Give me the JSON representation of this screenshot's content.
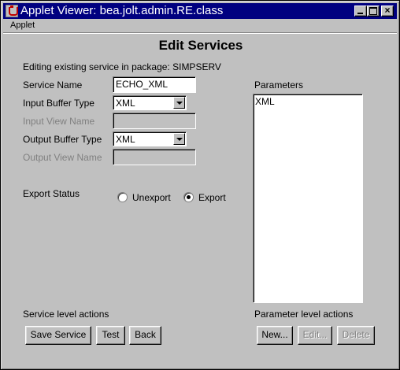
{
  "window": {
    "title": "Applet Viewer: bea.jolt.admin.RE.class",
    "close_glyph": "×"
  },
  "menubar": {
    "items": [
      "Applet"
    ]
  },
  "form": {
    "heading": "Edit Services",
    "subtitle": "Editing existing service in package: SIMPSERV",
    "service_name_label": "Service Name",
    "service_name_value": "ECHO_XML",
    "input_buffer_type_label": "Input Buffer Type",
    "input_buffer_type_value": "XML",
    "input_view_name_label": "Input View Name",
    "input_view_name_value": "",
    "output_buffer_type_label": "Output Buffer Type",
    "output_buffer_type_value": "XML",
    "output_view_name_label": "Output View Name",
    "output_view_name_value": "",
    "export_status_label": "Export Status",
    "export_options": [
      {
        "label": "Unexport",
        "selected": false
      },
      {
        "label": "Export",
        "selected": true
      }
    ]
  },
  "parameters": {
    "label": "Parameters",
    "items": [
      "XML"
    ]
  },
  "service_actions": {
    "label": "Service level actions",
    "save": "Save Service",
    "test": "Test",
    "back": "Back"
  },
  "parameter_actions": {
    "label": "Parameter level actions",
    "new": "New...",
    "edit": "Edit...",
    "delete": "Delete"
  }
}
